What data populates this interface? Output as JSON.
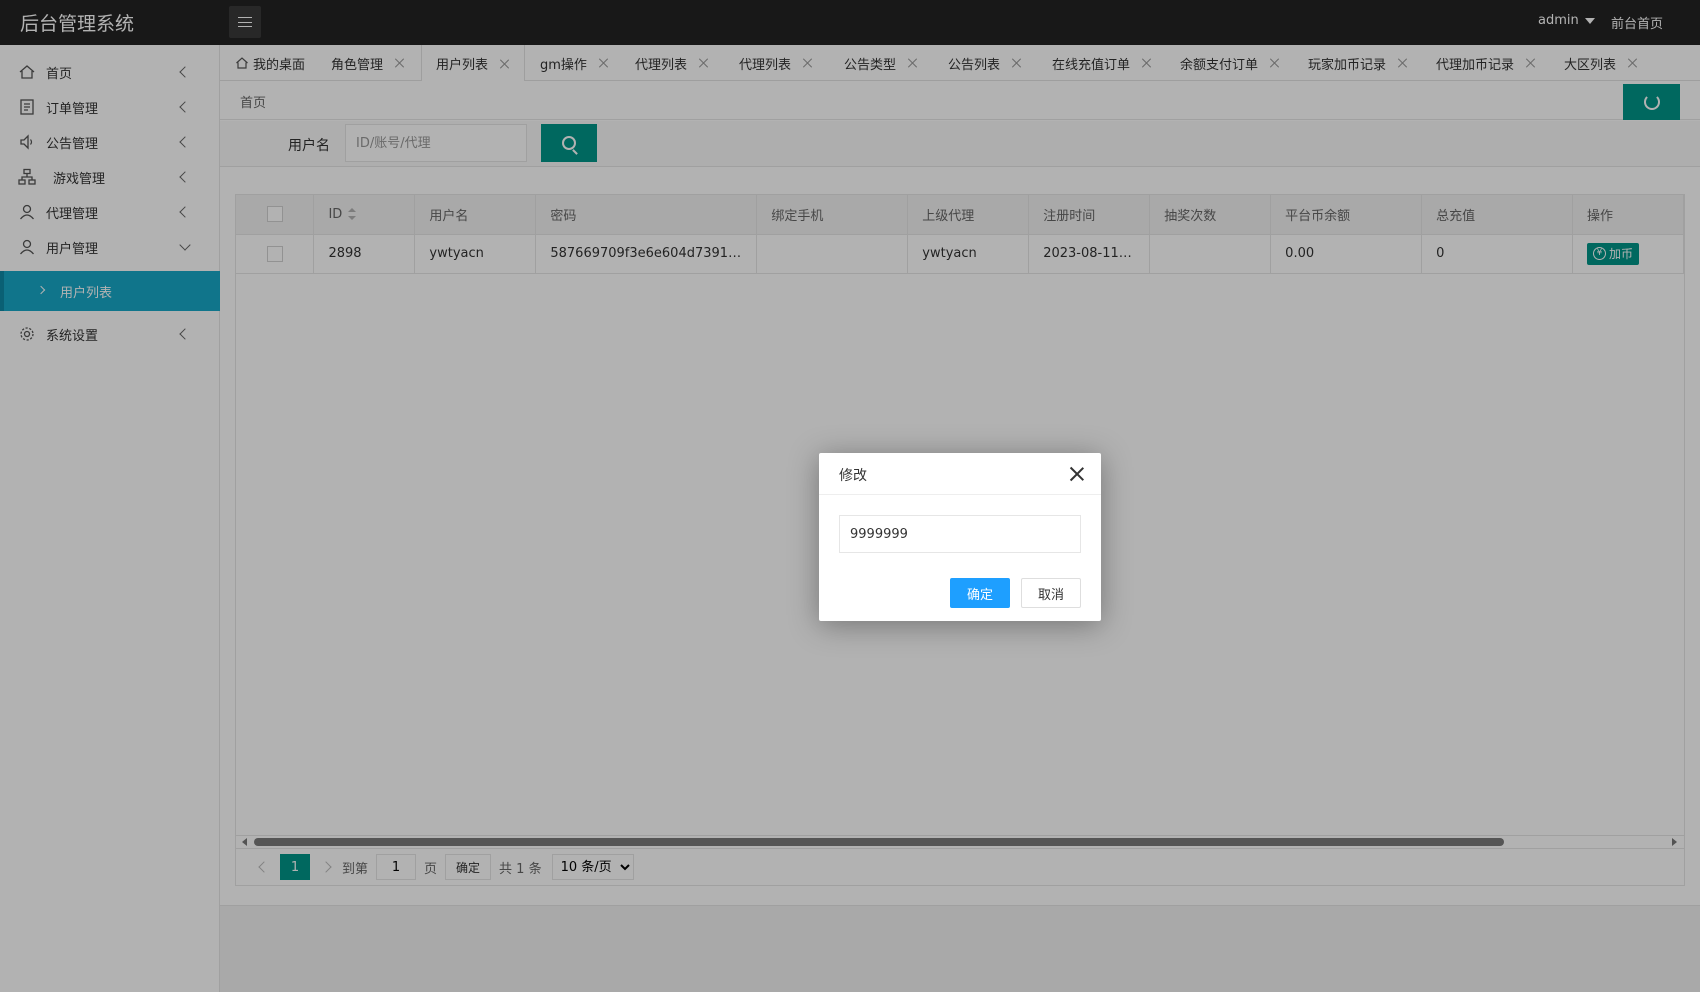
{
  "header": {
    "app_title": "后台管理系统",
    "user": "admin",
    "front_link": "前台首页"
  },
  "sidebar": {
    "items": [
      {
        "label": "首页",
        "icon": "home-icon"
      },
      {
        "label": "订单管理",
        "icon": "document-icon"
      },
      {
        "label": "公告管理",
        "icon": "speaker-icon"
      },
      {
        "label": "游戏管理",
        "icon": "sitemap-icon"
      },
      {
        "label": "代理管理",
        "icon": "user-icon"
      },
      {
        "label": "用户管理",
        "icon": "user-icon",
        "expanded": true
      },
      {
        "label": "系统设置",
        "icon": "gear-icon"
      }
    ],
    "sub_item": "用户列表"
  },
  "tabs": [
    "我的桌面",
    "角色管理",
    "用户列表",
    "gm操作",
    "代理列表",
    "代理列表",
    "公告类型",
    "公告列表",
    "在线充值订单",
    "余额支付订单",
    "玩家加币记录",
    "代理加币记录",
    "大区列表"
  ],
  "active_tab": 2,
  "breadcrumb": "首页",
  "search": {
    "label": "用户名",
    "placeholder": "ID/账号/代理"
  },
  "table": {
    "columns": [
      "ID",
      "用户名",
      "密码",
      "绑定手机",
      "上级代理",
      "注册时间",
      "抽奖次数",
      "平台币余额",
      "总充值",
      "操作"
    ],
    "rows": [
      {
        "id": "2898",
        "username": "ywtyacn",
        "password": "587669709f3e6e604d7391e...",
        "phone": "",
        "parent_agent": "ywtyacn",
        "reg_time": "2023-08-11 ...",
        "lottery": "",
        "balance": "0.00",
        "total_recharge": "0",
        "action": "加币"
      }
    ]
  },
  "pager": {
    "current": "1",
    "goto_label": "到第",
    "goto_value": "1",
    "page_unit": "页",
    "ok": "确定",
    "total": "共 1 条",
    "page_size": "10 条/页"
  },
  "modal": {
    "title": "修改",
    "value": "9999999",
    "ok": "确定",
    "cancel": "取消"
  },
  "colors": {
    "header_bg": "#232323",
    "accent": "#009688",
    "sidebar_active": "#17a8c8",
    "primary_button": "#1e9fff"
  }
}
